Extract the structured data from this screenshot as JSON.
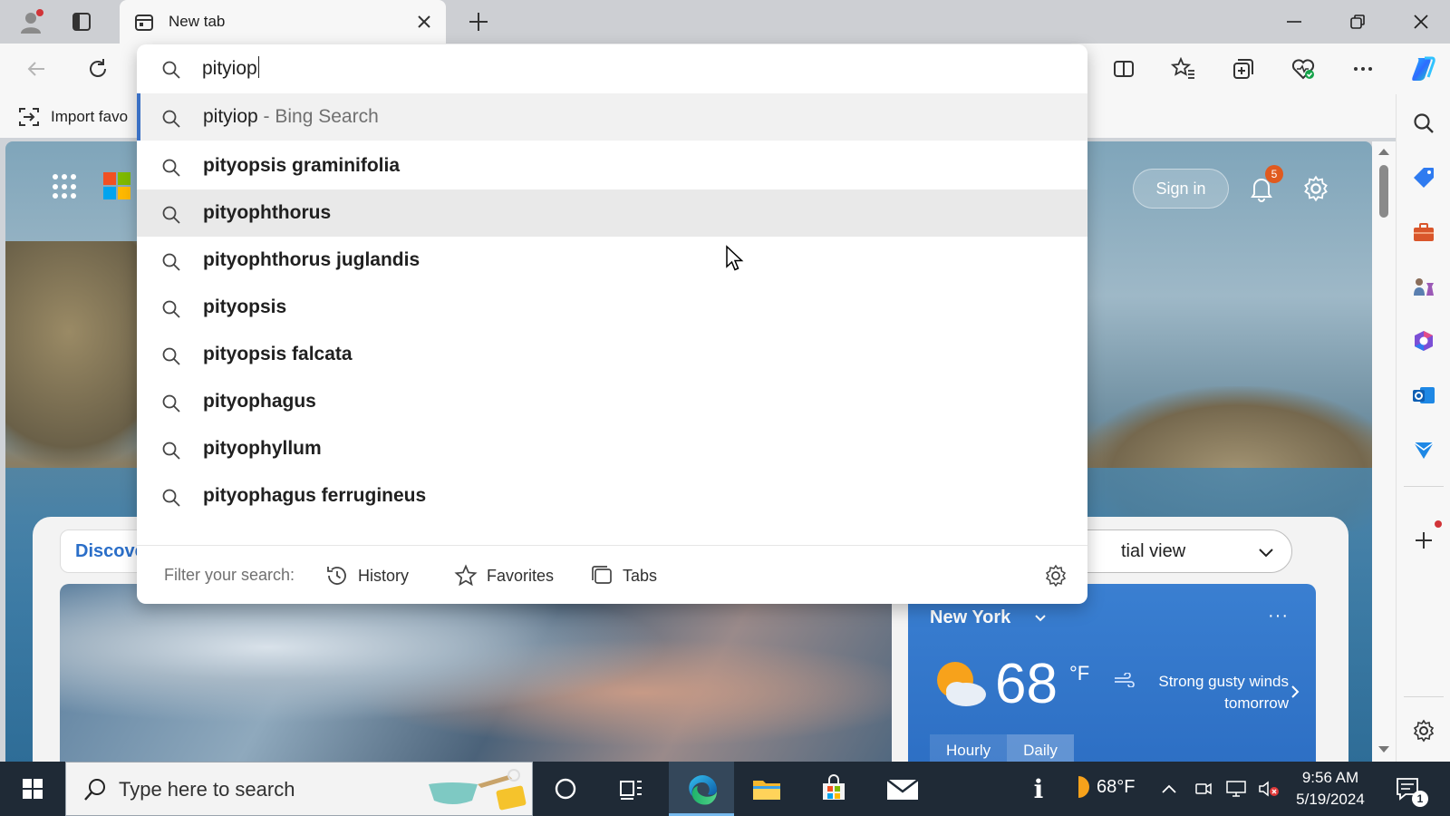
{
  "tab": {
    "title": "New tab"
  },
  "favorites_bar": {
    "import_label": "Import favo"
  },
  "ntp": {
    "signin_label": "Sign in",
    "notification_count": "5",
    "discover_label": "Discove",
    "view_select": "tial view"
  },
  "weather": {
    "city": "New York",
    "more": "···",
    "temp": "68",
    "unit": "°F",
    "wind_line1": "Strong gusty winds",
    "wind_line2": "tomorrow",
    "tab_hourly": "Hourly",
    "tab_daily": "Daily"
  },
  "search": {
    "query": "pityiop",
    "first_main": "pityiop",
    "first_suffix": " - Bing Search",
    "suggestions": [
      "pityopsis graminifolia",
      "pityophthorus",
      "pityophthorus juglandis",
      "pityopsis",
      "pityopsis falcata",
      "pityophagus",
      "pityophyllum",
      "pityophagus ferrugineus"
    ],
    "filter_label": "Filter your search:",
    "filter_history": "History",
    "filter_favorites": "Favorites",
    "filter_tabs": "Tabs"
  },
  "taskbar": {
    "search_placeholder": "Type here to search",
    "weather": "68°F",
    "time": "9:56 AM",
    "date": "5/19/2024",
    "notification_count": "1"
  },
  "colors": {
    "accent": "#3a70c4",
    "weather_card": "#2d6fc4",
    "notification": "#e05a1f",
    "taskbar": "#1f2a36"
  },
  "icons": [
    "profile-icon",
    "tab-actions-icon",
    "new-tab-icon",
    "close-icon",
    "plus-icon",
    "minimize-icon",
    "restore-icon",
    "back-icon",
    "refresh-icon",
    "split-screen-icon",
    "favorites-icon",
    "collections-icon",
    "browser-essentials-icon",
    "more-icon",
    "copilot-icon",
    "search-icon",
    "shopping-tag-icon",
    "tools-icon",
    "games-icon",
    "office-icon",
    "outlook-icon",
    "send-icon",
    "add-icon",
    "gear-icon",
    "apps-grid-icon",
    "bell-icon",
    "history-icon",
    "star-icon",
    "tabs-icon",
    "windows-start-icon",
    "cortana-icon",
    "task-view-icon",
    "edge-icon",
    "file-explorer-icon",
    "store-icon",
    "mail-icon"
  ]
}
